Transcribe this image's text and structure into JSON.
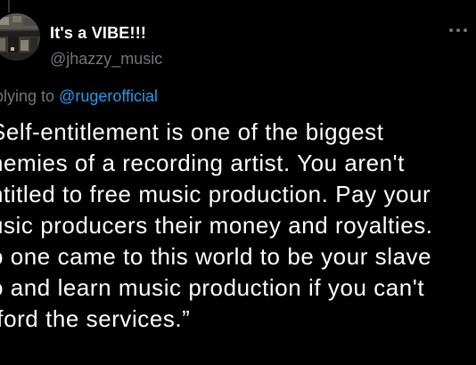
{
  "theme": {
    "background": "#000000",
    "text": "#ffffff",
    "secondary_text": "#71767b",
    "link": "#1d9bf0"
  },
  "author": {
    "display_name": "It's a VIBE!!!",
    "handle": "@jhazzy_music",
    "avatar_icon": "avatar-photo"
  },
  "reply": {
    "prefix": "plying to ",
    "mention": "@rugerofficial"
  },
  "tweet": {
    "lines": [
      "Self-entitlement is one of the biggest",
      "nemies of a recording artist. You aren't",
      "ntitled to free music production. Pay your",
      "usic producers their money and royalties.",
      "o one came to this world to be your slave",
      "o and learn music production if you can't",
      "fford the services.”"
    ]
  },
  "icons": {
    "more": "more-options-icon"
  }
}
